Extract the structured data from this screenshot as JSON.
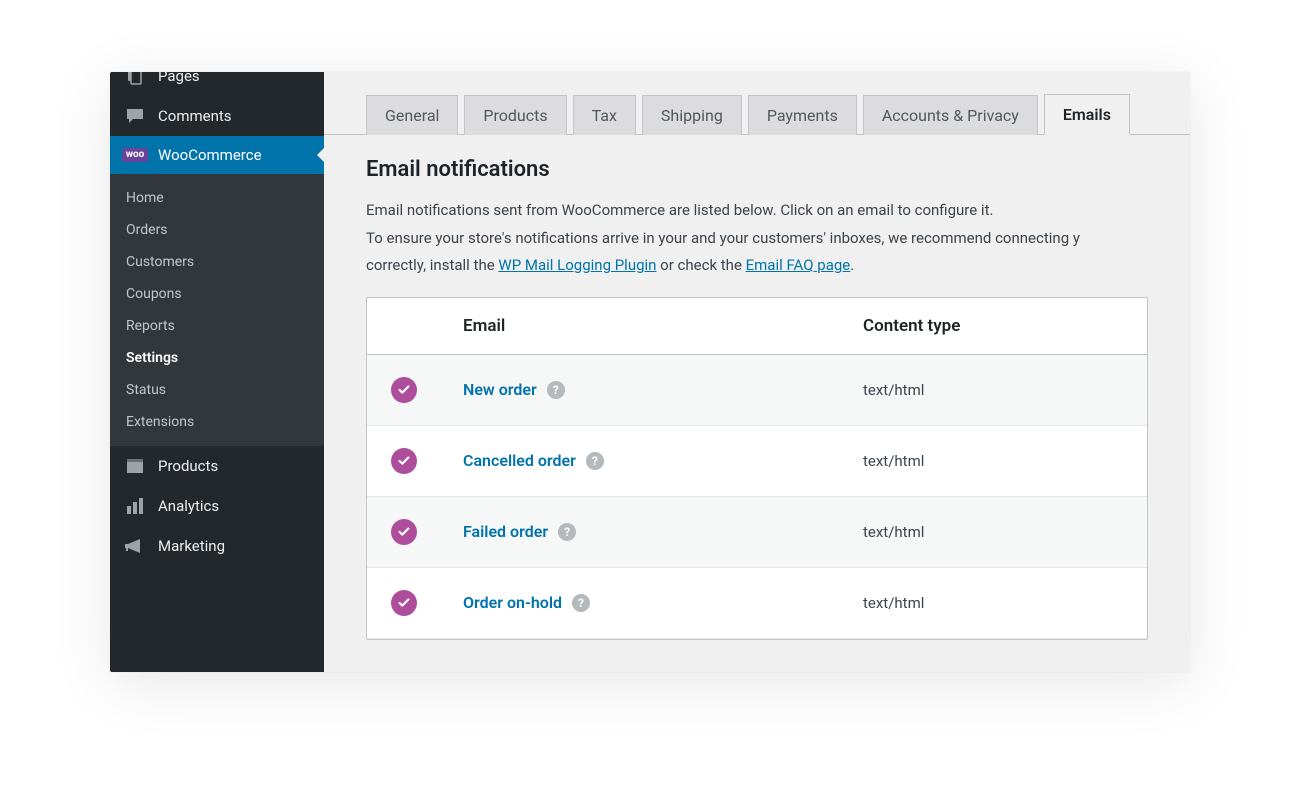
{
  "sidebar": {
    "top": [
      {
        "icon": "pages",
        "label": "Pages"
      },
      {
        "icon": "comments",
        "label": "Comments"
      }
    ],
    "active": {
      "label": "WooCommerce",
      "badge": "woo"
    },
    "submenu": [
      {
        "label": "Home",
        "current": false
      },
      {
        "label": "Orders",
        "current": false
      },
      {
        "label": "Customers",
        "current": false
      },
      {
        "label": "Coupons",
        "current": false
      },
      {
        "label": "Reports",
        "current": false
      },
      {
        "label": "Settings",
        "current": true
      },
      {
        "label": "Status",
        "current": false
      },
      {
        "label": "Extensions",
        "current": false
      }
    ],
    "bottom": [
      {
        "icon": "products",
        "label": "Products"
      },
      {
        "icon": "analytics",
        "label": "Analytics"
      },
      {
        "icon": "marketing",
        "label": "Marketing"
      }
    ]
  },
  "tabs": [
    {
      "label": "General",
      "active": false
    },
    {
      "label": "Products",
      "active": false
    },
    {
      "label": "Tax",
      "active": false
    },
    {
      "label": "Shipping",
      "active": false
    },
    {
      "label": "Payments",
      "active": false
    },
    {
      "label": "Accounts & Privacy",
      "active": false
    },
    {
      "label": "Emails",
      "active": true
    }
  ],
  "page": {
    "heading": "Email notifications",
    "desc1": "Email notifications sent from WooCommerce are listed below. Click on an email to configure it.",
    "desc2_a": "To ensure your store's notifications arrive in your and your customers' inboxes, we recommend connecting y",
    "desc2_b": "correctly, install the ",
    "link1": "WP Mail Logging Plugin",
    "desc2_c": " or check the ",
    "link2": "Email FAQ page",
    "desc2_d": "."
  },
  "table": {
    "headers": {
      "email": "Email",
      "type": "Content type"
    },
    "rows": [
      {
        "name": "New order",
        "type": "text/html",
        "enabled": true
      },
      {
        "name": "Cancelled order",
        "type": "text/html",
        "enabled": true
      },
      {
        "name": "Failed order",
        "type": "text/html",
        "enabled": true
      },
      {
        "name": "Order on-hold",
        "type": "text/html",
        "enabled": true
      }
    ]
  }
}
